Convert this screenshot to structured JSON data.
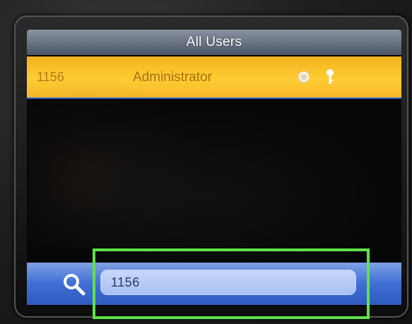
{
  "header": {
    "title": "All Users"
  },
  "users": [
    {
      "id": "1156",
      "role": "Administrator",
      "icons": [
        "fingerprint-icon",
        "key-icon"
      ]
    }
  ],
  "search": {
    "icon": "search-icon",
    "value": "1156"
  },
  "colors": {
    "selected_row": "#ffc933",
    "title_bar": "#6b7484",
    "search_bar": "#3f6ed4",
    "search_field": "#b6cbf5",
    "highlight_box": "#5ee24a"
  }
}
